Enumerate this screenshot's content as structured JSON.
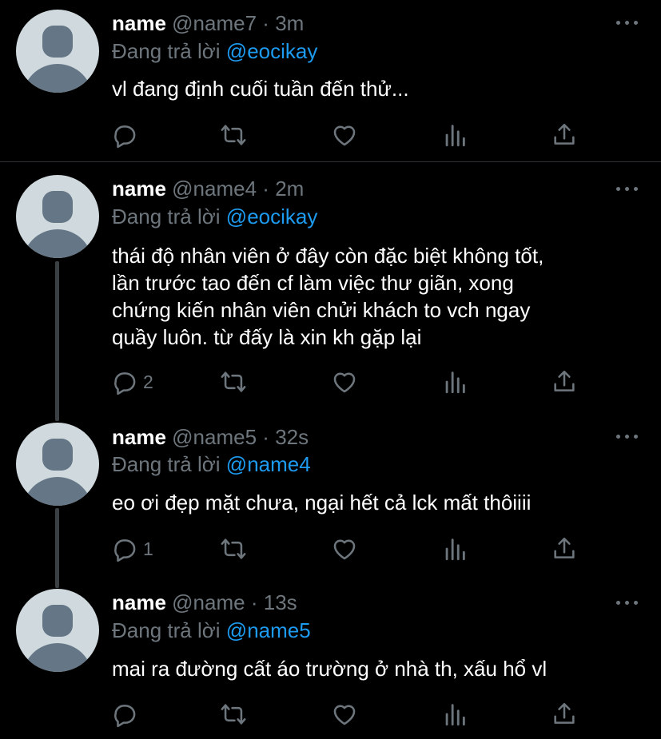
{
  "tweets": [
    {
      "name": "name",
      "handle": "@name7",
      "time": "3m",
      "replying_prefix": "Đang trả lời",
      "replying_to": "@eocikay",
      "lines": [
        "vl đang định cuối tuần đến thử..."
      ],
      "reply_count": ""
    },
    {
      "name": "name",
      "handle": "@name4",
      "time": "2m",
      "replying_prefix": "Đang trả lời",
      "replying_to": "@eocikay",
      "lines": [
        "thái độ nhân viên ở đây còn đặc biệt không tốt,",
        "lần trước tao đến cf làm việc thư giãn, xong",
        "chứng kiến nhân viên chửi khách to vch ngay",
        "quầy luôn. từ đấy là xin kh gặp lại"
      ],
      "reply_count": "2"
    },
    {
      "name": "name",
      "handle": "@name5",
      "time": "32s",
      "replying_prefix": "Đang trả lời",
      "replying_to": "@name4",
      "lines": [
        "eo ơi đẹp mặt chưa, ngại hết cả lck mất thôiiii"
      ],
      "reply_count": "1"
    },
    {
      "name": "name",
      "handle": "@name",
      "time": "13s",
      "replying_prefix": "Đang trả lời",
      "replying_to": "@name5",
      "lines": [
        "mai ra đường cất áo trường ở nhà th, xấu hổ vl"
      ],
      "reply_count": ""
    }
  ],
  "separator": "·",
  "icons": [
    "reply-icon",
    "retweet-icon",
    "like-icon",
    "analytics-icon",
    "share-icon",
    "more-icon"
  ],
  "colors": {
    "background": "#000000",
    "text": "#ffffff",
    "secondary": "#6e767d",
    "link": "#1d9bf0",
    "thread_line": "#3b4044",
    "avatar_bg": "#cfd9de",
    "avatar_fg": "#657786"
  }
}
